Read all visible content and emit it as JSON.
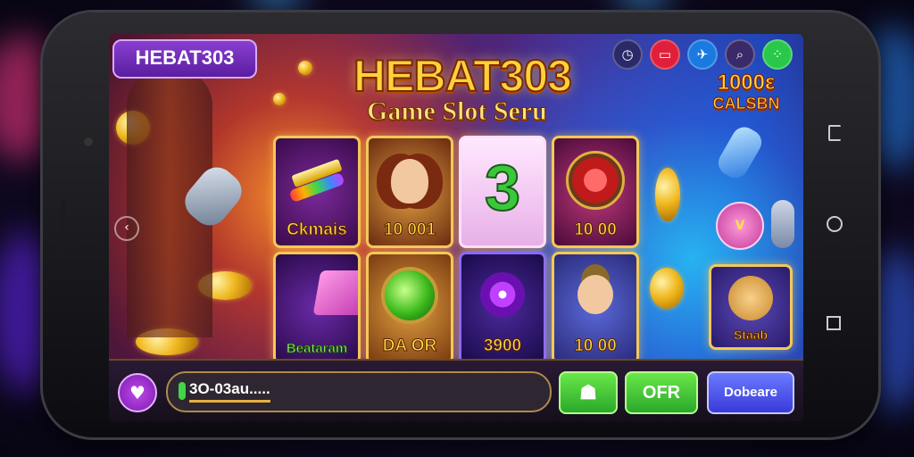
{
  "logo": {
    "text": "HEBAT303"
  },
  "header": {
    "title": "HEBAT303",
    "subtitle": "Game Slot Seru"
  },
  "top_icons": [
    {
      "icon": "clock-icon",
      "color": "#2a2a6a"
    },
    {
      "icon": "screen-icon",
      "color": "#e0203a"
    },
    {
      "icon": "bird-icon",
      "color": "#1a7ae0"
    },
    {
      "icon": "search-icon",
      "color": "#3a2a6a"
    },
    {
      "icon": "grid-icon",
      "color": "#2ac84a"
    }
  ],
  "bonus": {
    "line1": "1000ε",
    "line2": "CALSBN"
  },
  "tiles": [
    {
      "label": "Ckmais",
      "icon": "gold-bars-icon",
      "bg": "#4a1a6a",
      "label_style": "gold"
    },
    {
      "label": "10 001",
      "icon": "woman-character-icon",
      "bg": "#8a3a1a",
      "label_style": "gold"
    },
    {
      "label": "",
      "icon": "number-three-icon",
      "bg": "#f0d8f0",
      "label_style": "gold"
    },
    {
      "label": "10 00",
      "icon": "red-wheel-icon",
      "bg": "#5a1a4a",
      "label_style": "gold"
    },
    {
      "label": "Beataram",
      "icon": "pink-box-icon",
      "bg": "#3a1a6a",
      "label_style": "green"
    },
    {
      "label": "DA OR",
      "icon": "green-orb-icon",
      "bg": "#6a3a2a",
      "label_style": "gold"
    },
    {
      "label": "3900",
      "icon": "purple-swirl-icon",
      "bg": "#3a1a6a",
      "label_style": "gold"
    },
    {
      "label": "10 00",
      "icon": "explorer-character-icon",
      "bg": "#3a3a8a",
      "label_style": "gold"
    }
  ],
  "side_tile": {
    "label": "Staab",
    "icon": "lion-icon"
  },
  "bottom": {
    "balance": "3O-03au.....",
    "heart_icon": "heart-icon",
    "turtle_icon": "turtle-icon",
    "btn_ofr": "OFR",
    "btn_blue": "Dobeare"
  }
}
